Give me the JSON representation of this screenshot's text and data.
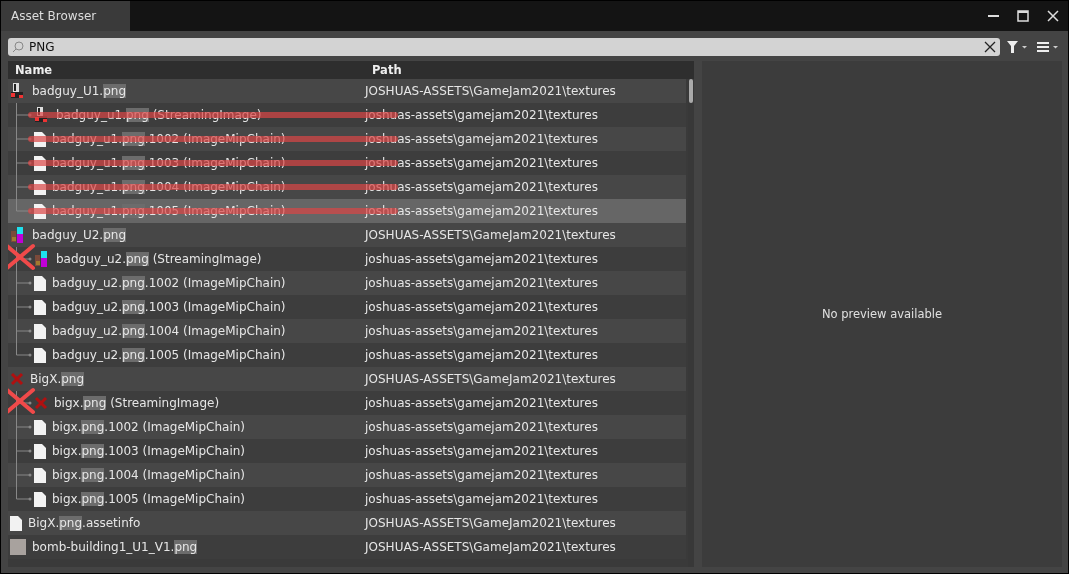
{
  "window": {
    "title": "Asset Browser"
  },
  "search": {
    "value": "PNG"
  },
  "table": {
    "columns": [
      "Name",
      "Path"
    ],
    "rows": [
      {
        "kind": "sprite-red",
        "name": {
          "before": "badguy_U1.",
          "match": "png"
        },
        "path": "JOSHUAS-ASSETS\\GameJam2021\\textures",
        "selected": false,
        "struck": false,
        "crossed": false,
        "children": [
          {
            "kind": "sprite-red",
            "name": {
              "before": "badguy_u1.",
              "match": "png",
              "after": " (StreamingImage)"
            },
            "path": "joshuas-assets\\gamejam2021\\textures",
            "selected": false,
            "struck": true,
            "crossed": false
          },
          {
            "kind": "file",
            "name": {
              "before": "badguy_u1.",
              "match": "png",
              "after": ".1002 (ImageMipChain)"
            },
            "path": "joshuas-assets\\gamejam2021\\textures",
            "selected": false,
            "struck": true,
            "crossed": false
          },
          {
            "kind": "file",
            "name": {
              "before": "badguy_u1.",
              "match": "png",
              "after": ".1003 (ImageMipChain)"
            },
            "path": "joshuas-assets\\gamejam2021\\textures",
            "selected": false,
            "struck": true,
            "crossed": false
          },
          {
            "kind": "file",
            "name": {
              "before": "badguy_u1.",
              "match": "png",
              "after": ".1004 (ImageMipChain)"
            },
            "path": "joshuas-assets\\gamejam2021\\textures",
            "selected": false,
            "struck": true,
            "crossed": false
          },
          {
            "kind": "file",
            "name": {
              "before": "badguy_u1.",
              "match": "png",
              "after": ".1005 (ImageMipChain)"
            },
            "path": "joshuas-assets\\gamejam2021\\textures",
            "selected": true,
            "struck": true,
            "crossed": false
          }
        ]
      },
      {
        "kind": "sprite-color",
        "name": {
          "before": "badguy_U2.",
          "match": "png"
        },
        "path": "JOSHUAS-ASSETS\\GameJam2021\\textures",
        "selected": false,
        "struck": false,
        "crossed": false,
        "children": [
          {
            "kind": "sprite-color",
            "name": {
              "before": "badguy_u2.",
              "match": "png",
              "after": " (StreamingImage)"
            },
            "path": "joshuas-assets\\gamejam2021\\textures",
            "selected": false,
            "struck": false,
            "crossed": true
          },
          {
            "kind": "file",
            "name": {
              "before": "badguy_u2.",
              "match": "png",
              "after": ".1002 (ImageMipChain)"
            },
            "path": "joshuas-assets\\gamejam2021\\textures",
            "selected": false,
            "struck": false,
            "crossed": false
          },
          {
            "kind": "file",
            "name": {
              "before": "badguy_u2.",
              "match": "png",
              "after": ".1003 (ImageMipChain)"
            },
            "path": "joshuas-assets\\gamejam2021\\textures",
            "selected": false,
            "struck": false,
            "crossed": false
          },
          {
            "kind": "file",
            "name": {
              "before": "badguy_u2.",
              "match": "png",
              "after": ".1004 (ImageMipChain)"
            },
            "path": "joshuas-assets\\gamejam2021\\textures",
            "selected": false,
            "struck": false,
            "crossed": false
          },
          {
            "kind": "file",
            "name": {
              "before": "badguy_u2.",
              "match": "png",
              "after": ".1005 (ImageMipChain)"
            },
            "path": "joshuas-assets\\gamejam2021\\textures",
            "selected": false,
            "struck": false,
            "crossed": false
          }
        ]
      },
      {
        "kind": "cross",
        "name": {
          "before": "BigX.",
          "match": "png"
        },
        "path": "JOSHUAS-ASSETS\\GameJam2021\\textures",
        "selected": false,
        "struck": false,
        "crossed": false,
        "children": [
          {
            "kind": "cross",
            "name": {
              "before": "bigx.",
              "match": "png",
              "after": " (StreamingImage)"
            },
            "path": "joshuas-assets\\gamejam2021\\textures",
            "selected": false,
            "struck": false,
            "crossed": true
          },
          {
            "kind": "file",
            "name": {
              "before": "bigx.",
              "match": "png",
              "after": ".1002 (ImageMipChain)"
            },
            "path": "joshuas-assets\\gamejam2021\\textures",
            "selected": false,
            "struck": false,
            "crossed": false
          },
          {
            "kind": "file",
            "name": {
              "before": "bigx.",
              "match": "png",
              "after": ".1003 (ImageMipChain)"
            },
            "path": "joshuas-assets\\gamejam2021\\textures",
            "selected": false,
            "struck": false,
            "crossed": false
          },
          {
            "kind": "file",
            "name": {
              "before": "bigx.",
              "match": "png",
              "after": ".1004 (ImageMipChain)"
            },
            "path": "joshuas-assets\\gamejam2021\\textures",
            "selected": false,
            "struck": false,
            "crossed": false
          },
          {
            "kind": "file",
            "name": {
              "before": "bigx.",
              "match": "png",
              "after": ".1005 (ImageMipChain)"
            },
            "path": "joshuas-assets\\gamejam2021\\textures",
            "selected": false,
            "struck": false,
            "crossed": false
          }
        ]
      },
      {
        "kind": "file",
        "name": {
          "before": "BigX.",
          "match": "png",
          "after": ".assetinfo"
        },
        "path": "JOSHUAS-ASSETS\\GameJam2021\\textures",
        "selected": false,
        "struck": false,
        "crossed": false
      },
      {
        "kind": "tile",
        "name": {
          "before": "bomb-building1_U1_V1.",
          "match": "png"
        },
        "path": "JOSHUAS-ASSETS\\GameJam2021\\textures",
        "selected": false,
        "struck": false,
        "crossed": false
      }
    ]
  },
  "preview": {
    "message": "No preview available"
  }
}
